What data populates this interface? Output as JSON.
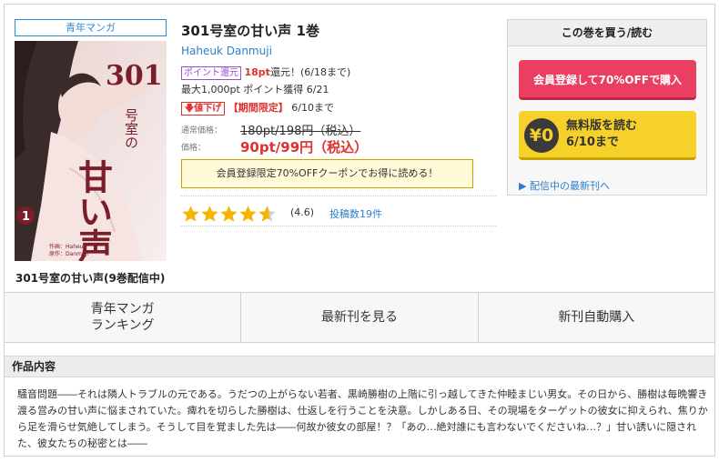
{
  "book": {
    "genre_tag": "青年マンガ",
    "title": "301号室の甘い声 1巻",
    "author": "Haheuk Danmuji",
    "series_title": "301号室の甘い声(9巻配信中)",
    "cover": {
      "vol_num": "1",
      "title_line1": "301",
      "title_line2": "号室の",
      "title_line3": "甘い声",
      "credit_line1": "作画：Haheuk",
      "credit_line2": "原作：Danmuji"
    }
  },
  "points": {
    "badge": "ポイント還元",
    "amount": "18pt",
    "suffix": "還元！(6/18まで)",
    "max_line": "最大1,000pt ポイント獲得 6/21"
  },
  "discount": {
    "badge": "値下げ",
    "limited": "【期間限定】",
    "until": "6/10まで"
  },
  "price": {
    "normal_label": "通常価格：",
    "normal_value": "180pt/198円（税込）",
    "sale_label": "価格：",
    "sale_value": "90pt/99円（税込）"
  },
  "coupon_text": "会員登録限定70%OFFクーポンでお得に読める！",
  "rating": {
    "value": 4.6,
    "display": "(4.6)",
    "reviews_link": "投稿数19件",
    "star_color": "#f5b400"
  },
  "buy": {
    "header": "この巻を買う/読む",
    "register_button": "会員登録して70%OFFで購入",
    "free_yen": "¥0",
    "free_line1": "無料版を読む",
    "free_line2": "6/10まで",
    "latest_link": "▶ 配信中の最新刊へ"
  },
  "menu": {
    "ranking_line1": "青年マンガ",
    "ranking_line2": "ランキング",
    "latest": "最新刊を見る",
    "auto_buy": "新刊自動購入"
  },
  "description": {
    "heading": "作品内容",
    "text": "騒音問題――それは隣人トラブルの元である。うだつの上がらない若者、黒崎勝樹の上階に引っ越してきた仲睦まじい男女。その日から、勝樹は毎晩響き渡る営みの甘い声に悩まされていた。痺れを切らした勝樹は、仕返しを行うことを決意。しかしある日、その現場をターゲットの彼女に抑えられ、焦りから足を滑らせ気絶してしまう。そうして目を覚ました先は――何故か彼女の部屋！？「あの…絶対誰にも言わないでくださいね…？」甘い誘いに隠された、彼女たちの秘密とは――"
  },
  "colors": {
    "link": "#2a7fc8",
    "red": "#e0312f",
    "register_button": "#ea3f60",
    "free_button": "#f6d12a"
  }
}
